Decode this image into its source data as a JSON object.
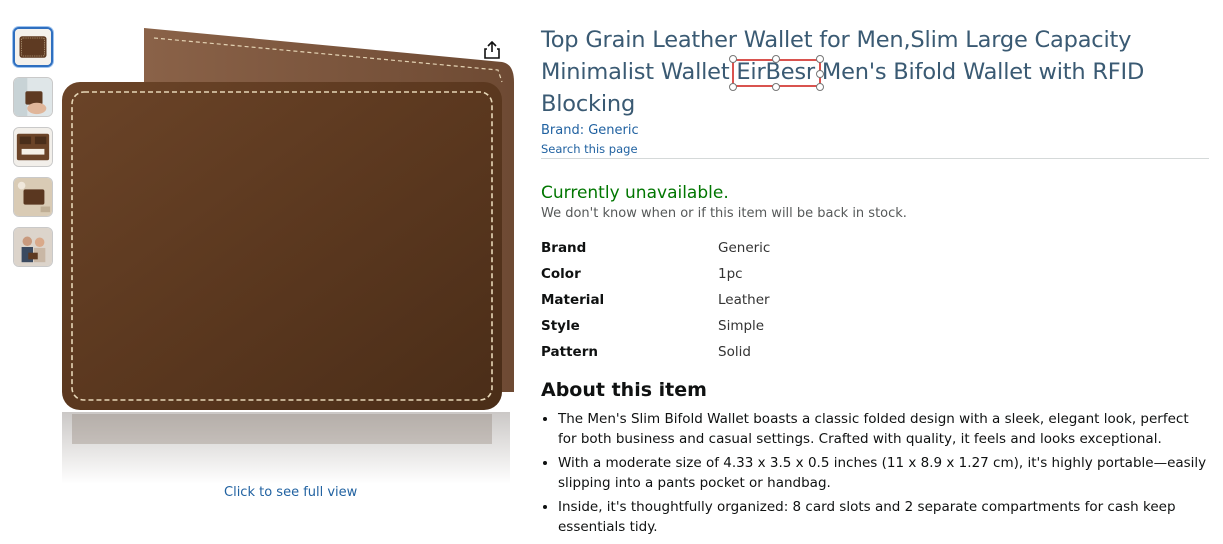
{
  "product": {
    "title_before": "Top Grain Leather Wallet for Men,Slim Large Capacity Minimalist Wallet ",
    "title_selected": "EirBesr",
    "title_after": " Men's Bifold Wallet with RFID Blocking",
    "brand_link": "Brand: Generic",
    "search_link": "Search this page"
  },
  "gallery": {
    "thumbnails": [
      {
        "icon": "wallet-front-thumb"
      },
      {
        "icon": "wallet-in-hand-thumb"
      },
      {
        "icon": "wallet-open-thumb"
      },
      {
        "icon": "wallet-desk-thumb"
      },
      {
        "icon": "couple-gift-thumb"
      }
    ],
    "full_view_label": "Click to see full view",
    "share_icon": "share-icon"
  },
  "availability": {
    "status": "Currently unavailable.",
    "note": "We don't know when or if this item will be back in stock."
  },
  "specs": [
    {
      "key": "Brand",
      "value": "Generic"
    },
    {
      "key": "Color",
      "value": "1pc"
    },
    {
      "key": "Material",
      "value": "Leather"
    },
    {
      "key": "Style",
      "value": "Simple"
    },
    {
      "key": "Pattern",
      "value": "Solid"
    }
  ],
  "about": {
    "heading": "About this item",
    "bullets": [
      "The Men's Slim Bifold Wallet boasts a classic folded design with a sleek, elegant look, perfect for both business and casual settings. Crafted with quality, it feels and looks exceptional.",
      "With a moderate size of 4.33 x 3.5 x 0.5 inches (11 x 8.9 x 1.27 cm), it's highly portable—easily slipping into a pants pocket or handbag.",
      "Inside, it's thoughtfully organized: 8 card slots and 2 separate compartments for cash keep essentials tidy."
    ]
  },
  "colors": {
    "link": "#2162a1",
    "title": "#3a5a73",
    "available_green": "#007600",
    "selection_box": "#d9534f",
    "leather": "#5e3a22"
  }
}
